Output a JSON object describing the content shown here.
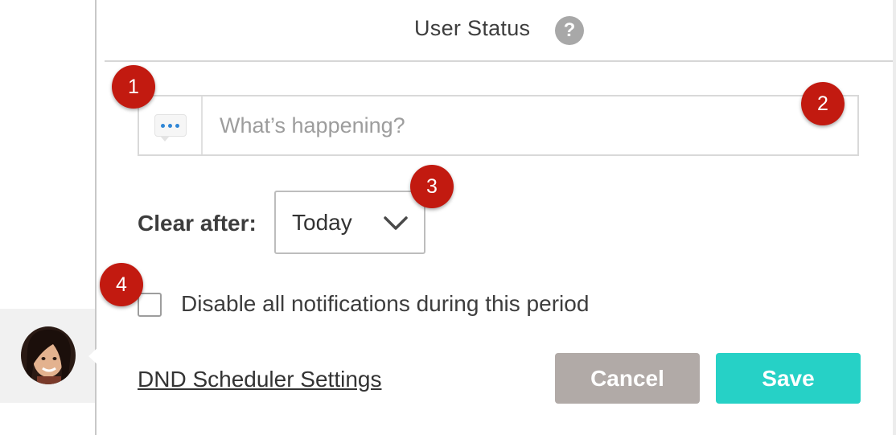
{
  "header": {
    "title": "User Status",
    "help_icon": "question-mark-icon",
    "help_glyph": "?"
  },
  "status_input": {
    "value": "",
    "placeholder": "What’s happening?",
    "emoji_icon": "speech-bubble-icon"
  },
  "clear_after": {
    "label": "Clear after:",
    "selected": "Today"
  },
  "notifications": {
    "label": "Disable all notifications during this period",
    "checked": false
  },
  "footer": {
    "dnd_link": "DND Scheduler Settings",
    "cancel_label": "Cancel",
    "save_label": "Save"
  },
  "markers": [
    {
      "label": "1"
    },
    {
      "label": "2"
    },
    {
      "label": "3"
    },
    {
      "label": "4"
    }
  ],
  "colors": {
    "save": "#26d1c6",
    "cancel": "#b1aaa7",
    "marker": "#c21a10",
    "emoji_dots": "#2f86d6"
  }
}
